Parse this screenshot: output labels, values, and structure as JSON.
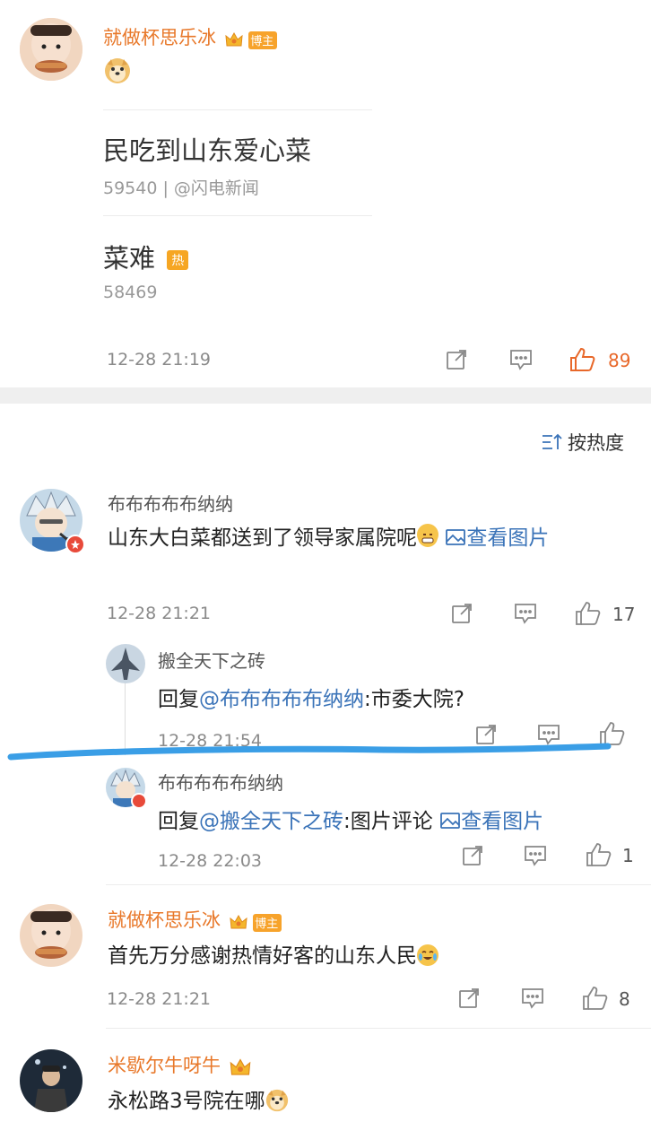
{
  "post": {
    "author": "就做杯思乐冰",
    "author_badge": "博主",
    "emoji": "doge",
    "trend1_title": "民吃到山东爱心菜",
    "trend1_meta": "59540 | @闪电新闻",
    "trend2_title": "菜难",
    "trend2_tag": "热",
    "trend2_meta": "58469",
    "time": "12-28 21:19",
    "likes": "89"
  },
  "sort": {
    "label": "按热度"
  },
  "comments": [
    {
      "author": "布布布布布纳纳",
      "text": "山东大白菜都送到了领导家属院呢",
      "link_text": "查看图片",
      "time": "12-28 21:21",
      "likes": "17",
      "replies": [
        {
          "author": "搬全天下之砖",
          "prefix": "回复",
          "mention": "@布布布布布纳纳",
          "text": ":市委大院?",
          "time": "12-28 21:54",
          "likes": ""
        },
        {
          "author": "布布布布布纳纳",
          "prefix": "回复",
          "mention": "@搬全天下之砖",
          "text": ":图片评论",
          "link_text": "查看图片",
          "time": "12-28 22:03",
          "likes": "1"
        }
      ]
    },
    {
      "author": "就做杯思乐冰",
      "author_badge": "博主",
      "text": "首先万分感谢热情好客的山东人民",
      "time": "12-28 21:21",
      "likes": "8"
    },
    {
      "author": "米歇尔牛呀牛",
      "text": "永松路3号院在哪"
    }
  ],
  "colors": {
    "accent_orange": "#e8782a",
    "link_blue": "#3a73b8",
    "annotation_blue": "#3a9ee6"
  }
}
